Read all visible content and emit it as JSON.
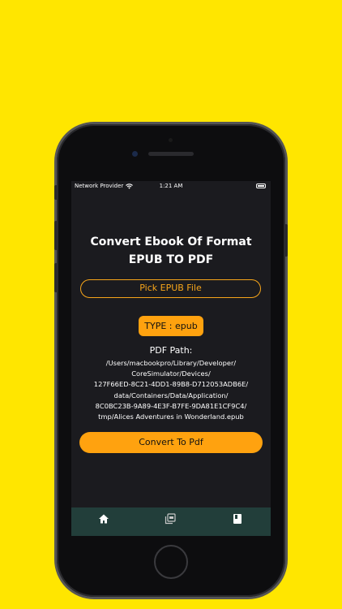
{
  "status_bar": {
    "carrier": "Network Provider",
    "time": "1:21 AM"
  },
  "main": {
    "title_line1": "Convert Ebook Of Format",
    "title_line2": "EPUB TO PDF",
    "pick_button": "Pick EPUB File",
    "type_badge": "TYPE : epub",
    "pdf_path_label": "PDF Path:",
    "path_lines": [
      "/Users/macbookpro/Library/Developer/",
      "CoreSimulator/Devices/",
      "127F66ED-8C21-4DD1-89B8-D712053ADB6E/",
      "data/Containers/Data/Application/",
      "8C0BC23B-9A89-4E3F-B7FE-9DA81E1CF9C4/",
      "tmp/Alices Adventures in Wonderland.epub"
    ],
    "convert_button": "Convert To Pdf"
  },
  "tab_bar": {
    "tabs": [
      "home-icon",
      "pdf-files-icon",
      "book-icon"
    ]
  },
  "colors": {
    "background": "#ffe600",
    "accent": "#ffa20f",
    "screen": "#1b1b1f",
    "tab_bar": "#223e3a"
  }
}
